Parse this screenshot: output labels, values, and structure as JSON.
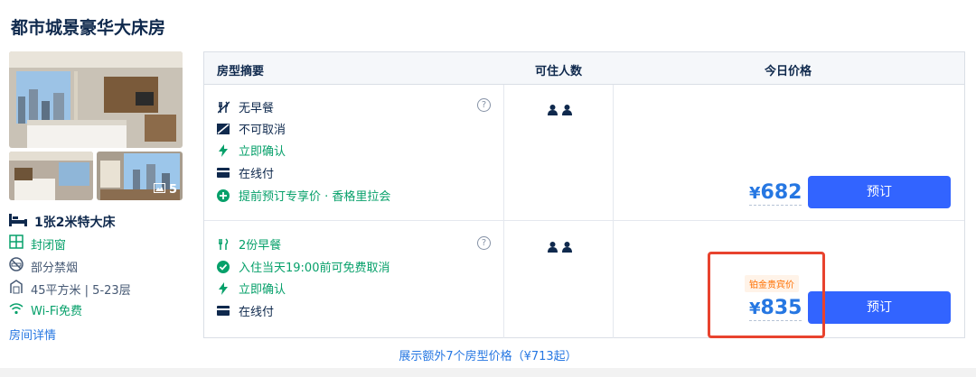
{
  "room": {
    "title": "都市城景豪华大床房",
    "photo_count": "5",
    "bed": "1张2米特大床",
    "window": "封闭窗",
    "smoking": "部分禁烟",
    "area_floor": "45平方米 | 5-23层",
    "wifi": "Wi-Fi免费",
    "details_link": "房间详情"
  },
  "table": {
    "headers": {
      "summary": "房型摘要",
      "guests": "可住人数",
      "price": "今日价格"
    },
    "rates": [
      {
        "policies": [
          {
            "icon": "no-breakfast-icon",
            "text": "无早餐",
            "green": false
          },
          {
            "icon": "no-cancel-icon",
            "text": "不可取消",
            "green": false
          },
          {
            "icon": "lightning-icon",
            "text": "立即确认",
            "green": true
          },
          {
            "icon": "card-icon",
            "text": "在线付",
            "green": false
          },
          {
            "icon": "plus-circle-icon",
            "text": "提前预订专享价 · 香格里拉会",
            "green": true
          }
        ],
        "guests": 2,
        "currency": "¥",
        "price": "682",
        "tag": "",
        "book": "预订"
      },
      {
        "policies": [
          {
            "icon": "breakfast-icon",
            "text": "2份早餐",
            "green": true
          },
          {
            "icon": "check-circle-icon",
            "text": "入住当天19:00前可免费取消",
            "green": true
          },
          {
            "icon": "lightning-icon",
            "text": "立即确认",
            "green": true
          },
          {
            "icon": "card-icon",
            "text": "在线付",
            "green": false
          }
        ],
        "guests": 2,
        "currency": "¥",
        "price": "835",
        "tag": "铂金贵宾价",
        "book": "预订"
      }
    ]
  },
  "more_rates": "展示额外7个房型价格（¥713起）",
  "colors": {
    "accent": "#2677e2",
    "button": "#3264ff",
    "green": "#06a06a",
    "highlight": "#e8432e",
    "tag": "#ff6f00"
  }
}
